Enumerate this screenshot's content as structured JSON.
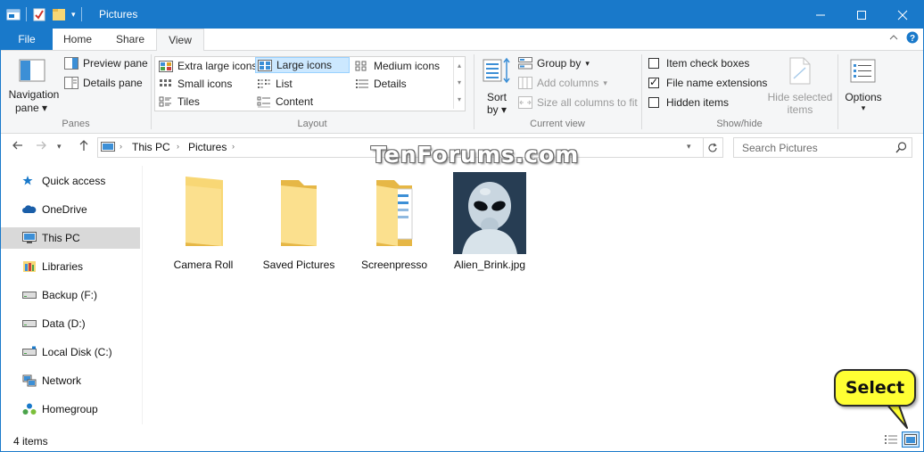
{
  "window": {
    "title": "Pictures"
  },
  "tabs": [
    {
      "label": "File"
    },
    {
      "label": "Home"
    },
    {
      "label": "Share"
    },
    {
      "label": "View"
    }
  ],
  "ribbon": {
    "panes": {
      "navigation_pane_line1": "Navigation",
      "navigation_pane_line2": "pane",
      "preview_pane": "Preview pane",
      "details_pane": "Details pane",
      "label": "Panes"
    },
    "layout": {
      "options": [
        "Extra large icons",
        "Large icons",
        "Medium icons",
        "Small icons",
        "List",
        "Details",
        "Tiles",
        "Content"
      ],
      "selected": "Large icons",
      "label": "Layout"
    },
    "current_view": {
      "sort_by_line1": "Sort",
      "sort_by_line2": "by",
      "group_by": "Group by",
      "add_columns": "Add columns",
      "size_all_columns": "Size all columns to fit",
      "label": "Current view"
    },
    "show_hide": {
      "item_check_boxes": "Item check boxes",
      "file_name_extensions": "File name extensions",
      "hidden_items": "Hidden items",
      "hide_selected_line1": "Hide selected",
      "hide_selected_line2": "items",
      "label": "Show/hide",
      "item_check_boxes_checked": false,
      "file_name_extensions_checked": true,
      "hidden_items_checked": false
    },
    "options": {
      "label": "Options"
    }
  },
  "address": {
    "crumbs": [
      "This PC",
      "Pictures"
    ],
    "search_placeholder": "Search Pictures"
  },
  "nav": {
    "items": [
      {
        "label": "Quick access",
        "icon": "star-icon"
      },
      {
        "label": "OneDrive",
        "icon": "cloud-icon"
      },
      {
        "label": "This PC",
        "icon": "monitor-icon",
        "selected": true
      },
      {
        "label": "Libraries",
        "icon": "library-icon"
      },
      {
        "label": "Backup (F:)",
        "icon": "drive-icon"
      },
      {
        "label": "Data (D:)",
        "icon": "drive-icon"
      },
      {
        "label": "Local Disk (C:)",
        "icon": "drive-icon"
      },
      {
        "label": "Network",
        "icon": "network-icon"
      },
      {
        "label": "Homegroup",
        "icon": "homegroup-icon"
      }
    ]
  },
  "files": [
    {
      "name": "Camera Roll",
      "type": "folder"
    },
    {
      "name": "Saved Pictures",
      "type": "folder"
    },
    {
      "name": "Screenpresso",
      "type": "folder-with-content"
    },
    {
      "name": "Alien_Brink.jpg",
      "type": "image"
    }
  ],
  "watermark": "TenForums.com",
  "status": {
    "item_count": "4 items"
  },
  "callout": {
    "text": "Select"
  },
  "colors": {
    "accent": "#1979ca",
    "selection": "#cce8ff",
    "folder": "#f8d775",
    "callout": "#ffff33"
  }
}
